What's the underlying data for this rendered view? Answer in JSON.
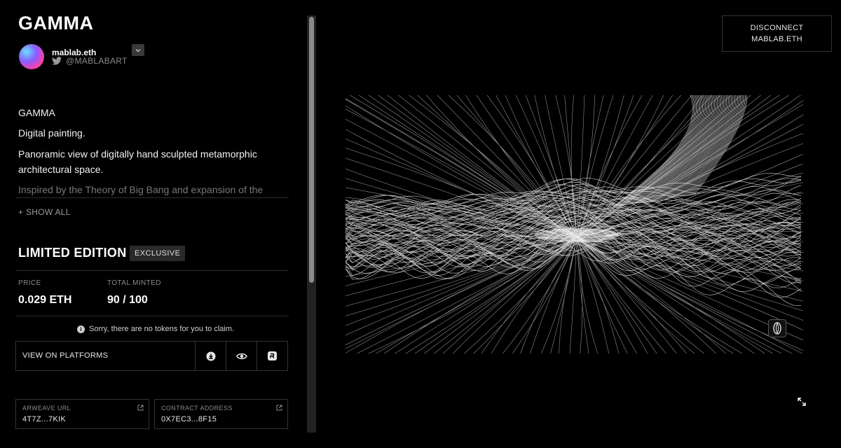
{
  "artwork": {
    "title": "GAMMA"
  },
  "artist": {
    "name": "mablab.eth",
    "twitter_handle": "@MABLABART",
    "icon": "twitter-icon"
  },
  "description": {
    "line1": "GAMMA",
    "line2": "Digital painting.",
    "line3": "Panoramic view of digitally hand sculpted metamorphic architectural space.",
    "line4": "Inspired by the Theory of Big Bang and expansion of the",
    "show_all_label": "+ SHOW ALL"
  },
  "edition": {
    "label": "LIMITED EDITION",
    "badge": "EXCLUSIVE"
  },
  "stats": {
    "price_label": "PRICE",
    "price_value": "0.029 ETH",
    "minted_label": "TOTAL MINTED",
    "minted_value": "90 / 100"
  },
  "notice": "Sorry, there are no tokens for you to claim.",
  "platforms": {
    "label": "VIEW ON PLATFORMS",
    "icons": [
      "download-icon",
      "eye-icon",
      "rarible-icon"
    ]
  },
  "arweave": {
    "label": "ARWEAVE URL",
    "value": "4T7Z...7KIK"
  },
  "contract": {
    "label": "CONTRACT ADDRESS",
    "value": "0X7EC3...8F15"
  },
  "wallet": {
    "line1": "DISCONNECT",
    "line2": "MABLAB.ETH"
  },
  "colors": {
    "background": "#000000",
    "text": "#ffffff",
    "muted": "#8a8a8a",
    "border": "#333333"
  }
}
